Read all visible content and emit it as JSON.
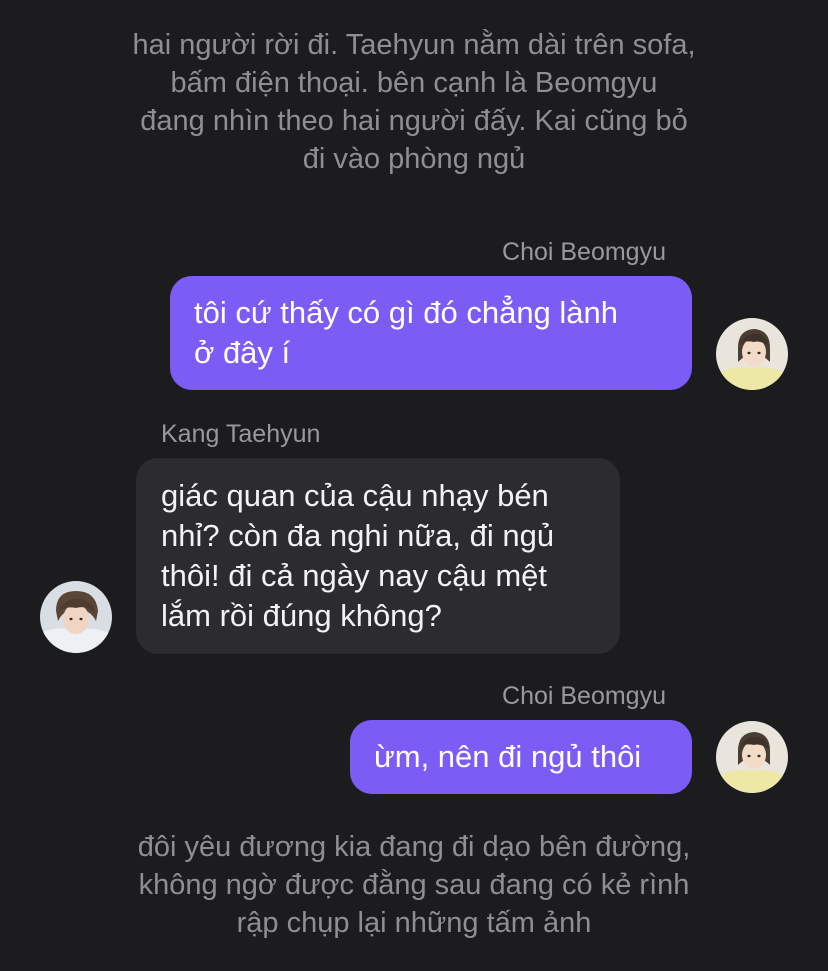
{
  "narration_top": {
    "lines": [
      "hai người rời đi. Taehyun nằm dài trên sofa,",
      "bấm điện thoại. bên cạnh là Beomgyu",
      "đang nhìn theo hai người đấy. Kai cũng bỏ",
      "đi vào phòng ngủ"
    ]
  },
  "messages": [
    {
      "sender": "Choi Beomgyu",
      "lines": [
        "tôi cứ thấy có gì đó chẳng lành",
        "ở đây í"
      ]
    },
    {
      "sender": "Kang Taehyun",
      "lines": [
        "giác quan của cậu nhạy bén",
        "nhỉ? còn đa nghi nữa, đi ngủ",
        "thôi! đi cả ngày nay cậu mệt",
        "lắm rồi đúng không?"
      ]
    },
    {
      "sender": "Choi Beomgyu",
      "lines": [
        "ừm, nên đi ngủ thôi"
      ]
    }
  ],
  "narration_bottom": {
    "lines": [
      "đôi yêu đương kia đang đi dạo bên đường,",
      "không ngờ được đằng sau đang có kẻ rình",
      "rập chụp lại những tấm ảnh"
    ]
  },
  "colors": {
    "background": "#1c1c1e",
    "outgoing_bubble": "#7b5cf5",
    "incoming_bubble": "#2c2c2e",
    "narration_text": "#8e8e93",
    "sender_text": "#98989f"
  },
  "icons": {
    "beomgyu_avatar": "avatar-photo-beomgyu",
    "taehyun_avatar": "avatar-photo-taehyun"
  }
}
